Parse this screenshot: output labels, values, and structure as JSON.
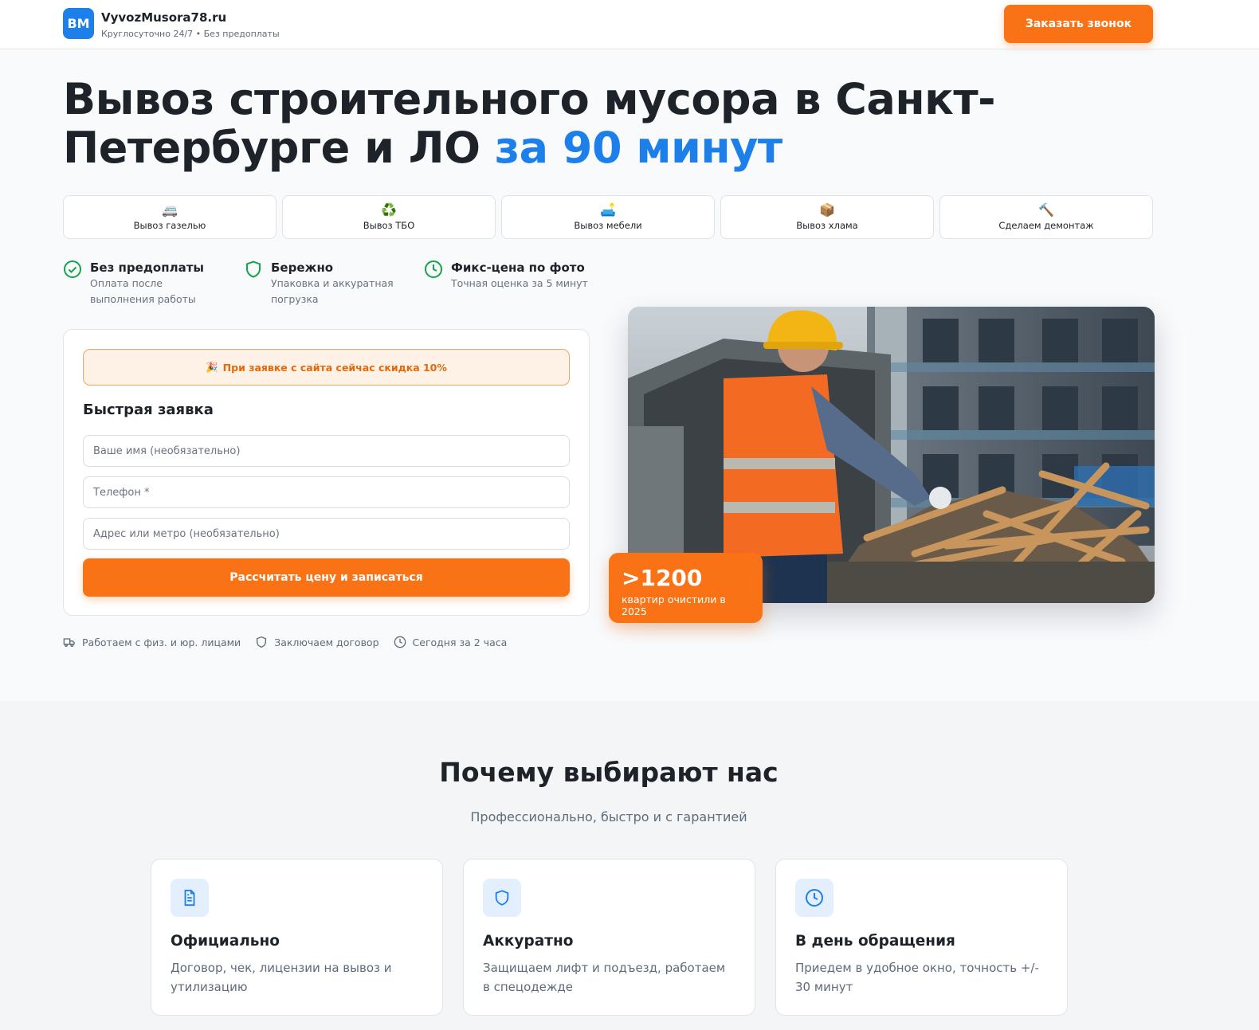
{
  "header": {
    "logo_text": "BM",
    "brand": "VyvozMusora78.ru",
    "subtitle": "Круглосуточно 24/7 • Без предоплаты",
    "call_button": "Заказать звонок"
  },
  "hero": {
    "title_main": "Вывоз строительного мусора в Санкт-Петербурге и ЛО ",
    "title_accent": "за 90 минут"
  },
  "services": [
    {
      "label": "Вывоз газелью",
      "icon": "truck-icon",
      "glyph": "🚐"
    },
    {
      "label": "Вывоз ТБО",
      "icon": "recycle-icon",
      "glyph": "♻️"
    },
    {
      "label": "Вывоз мебели",
      "icon": "sofa-icon",
      "glyph": "🛋️"
    },
    {
      "label": "Вывоз хлама",
      "icon": "box-icon",
      "glyph": "📦"
    },
    {
      "label": "Сделаем демонтаж",
      "icon": "hammer-icon",
      "glyph": "🔨"
    }
  ],
  "benefits": [
    {
      "title": "Без предоплаты",
      "text": "Оплата после выполнения работы",
      "icon": "check-circle-icon"
    },
    {
      "title": "Бережно",
      "text": "Упаковка и аккуратная погрузка",
      "icon": "shield-icon"
    },
    {
      "title": "Фикс-цена по фото",
      "text": "Точная оценка за 5 минут",
      "icon": "clock-icon"
    }
  ],
  "form": {
    "promo_icon": "🎉",
    "promo": "При заявке с сайта сейчас скидка 10%",
    "title": "Быстрая заявка",
    "name_placeholder": "Ваше имя (необязательно)",
    "phone_placeholder": "Телефон *",
    "address_placeholder": "Адрес или метро (необязательно)",
    "submit": "Рассчитать цену и записаться"
  },
  "trust": [
    {
      "label": "Работаем с физ. и юр. лицами",
      "icon": "truck-icon"
    },
    {
      "label": "Заключаем договор",
      "icon": "shield-icon"
    },
    {
      "label": "Сегодня за 2 часа",
      "icon": "clock-icon"
    }
  ],
  "stat": {
    "number": ">1200",
    "label": "квартир очистили в 2025"
  },
  "why": {
    "title": "Почему выбирают нас",
    "subtitle": "Профессионально, быстро и с гарантией",
    "cards": [
      {
        "title": "Официально",
        "text": "Договор, чек, лицензии на вывоз и утилизацию",
        "icon": "document-icon"
      },
      {
        "title": "Аккуратно",
        "text": "Защищаем лифт и подъезд, работаем в спецодежде",
        "icon": "shield-icon"
      },
      {
        "title": "В день обращения",
        "text": "Приедем в удобное окно, точность +/- 30 минут",
        "icon": "clock-icon"
      }
    ]
  },
  "colors": {
    "accent_blue": "#1d7fea",
    "accent_orange": "#f97316",
    "success_green": "#16a34a"
  }
}
